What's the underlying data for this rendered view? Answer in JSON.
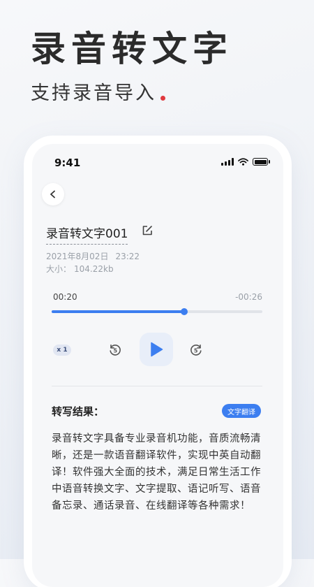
{
  "hero": {
    "title": "录音转文字",
    "subtitle": "支持录音导入"
  },
  "status_bar": {
    "time": "9:41"
  },
  "recording": {
    "title": "录音转文字001",
    "date": "2021年8月02日",
    "time": "23:22",
    "size_label": "大小：",
    "size_value": "104.22kb"
  },
  "player": {
    "current_time": "00:20",
    "remaining_time": "-00:26",
    "progress": 0.63,
    "speed_label": "x 1",
    "rewind_seconds": "5",
    "forward_seconds": "5"
  },
  "result": {
    "label": "转写结果：",
    "translate_button": "文字翻译",
    "text": "录音转文字具备专业录音机功能，音质流畅清晰，还是一款语音翻译软件，实现中英自动翻译！软件强大全面的技术，满足日常生活工作中语音转换文字、文字提取、语记听写、语音备忘录、通话录音、在线翻译等各种需求！"
  },
  "colors": {
    "accent": "#3c7ef0",
    "hero_dot": "#e0393e"
  },
  "icons": [
    "back-arrow-icon",
    "edit-icon",
    "signal-icon",
    "wifi-icon",
    "battery-icon",
    "rewind-5-icon",
    "play-icon",
    "forward-5-icon"
  ]
}
